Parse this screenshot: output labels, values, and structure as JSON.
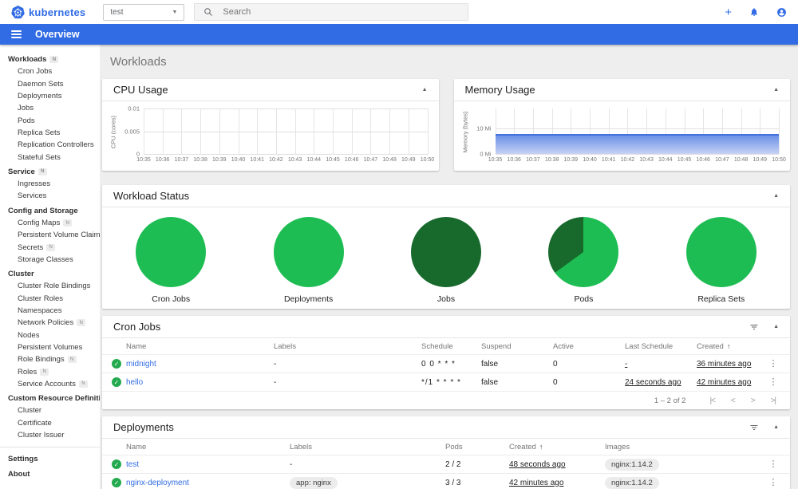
{
  "colors": {
    "brand_blue": "#326ce5",
    "link_blue": "#326ce5",
    "pie_green": "#1ebd53",
    "pie_dark_green": "#17692c",
    "status_ok_green": "#23a94e",
    "memory_fill_top": "#6b91e7",
    "memory_fill_bottom": "#c6d2f4"
  },
  "header": {
    "logo_text": "kubernetes",
    "namespace_value": "test",
    "search_placeholder": "Search"
  },
  "navbar": {
    "title": "Overview"
  },
  "page": {
    "title": "Workloads"
  },
  "sidebar": {
    "groups": [
      {
        "label": "Workloads",
        "badge": true,
        "items": [
          {
            "label": "Cron Jobs"
          },
          {
            "label": "Daemon Sets"
          },
          {
            "label": "Deployments"
          },
          {
            "label": "Jobs"
          },
          {
            "label": "Pods"
          },
          {
            "label": "Replica Sets"
          },
          {
            "label": "Replication Controllers"
          },
          {
            "label": "Stateful Sets"
          }
        ]
      },
      {
        "label": "Service",
        "badge": true,
        "items": [
          {
            "label": "Ingresses"
          },
          {
            "label": "Services"
          }
        ]
      },
      {
        "label": "Config and Storage",
        "badge": false,
        "items": [
          {
            "label": "Config Maps",
            "badge": true
          },
          {
            "label": "Persistent Volume Claims",
            "badge": true
          },
          {
            "label": "Secrets",
            "badge": true
          },
          {
            "label": "Storage Classes"
          }
        ]
      },
      {
        "label": "Cluster",
        "badge": false,
        "items": [
          {
            "label": "Cluster Role Bindings"
          },
          {
            "label": "Cluster Roles"
          },
          {
            "label": "Namespaces"
          },
          {
            "label": "Network Policies",
            "badge": true
          },
          {
            "label": "Nodes"
          },
          {
            "label": "Persistent Volumes"
          },
          {
            "label": "Role Bindings",
            "badge": true
          },
          {
            "label": "Roles",
            "badge": true
          },
          {
            "label": "Service Accounts",
            "badge": true
          }
        ]
      },
      {
        "label": "Custom Resource Definitions",
        "badge": false,
        "items": [
          {
            "label": "Cluster"
          },
          {
            "label": "Certificate"
          },
          {
            "label": "Cluster Issuer"
          }
        ]
      }
    ],
    "footer_items": [
      {
        "label": "Settings"
      },
      {
        "label": "About"
      }
    ]
  },
  "chart_data": [
    {
      "id": "cpu",
      "type": "line",
      "title": "CPU Usage",
      "ylabel": "CPU (cores)",
      "x": [
        "10:35",
        "10:36",
        "10:37",
        "10:38",
        "10:39",
        "10:40",
        "10:41",
        "10:42",
        "10:43",
        "10:44",
        "10:45",
        "10:46",
        "10:47",
        "10:48",
        "10:49",
        "10:50"
      ],
      "yticks": [
        "0.01",
        "0.005",
        "0"
      ],
      "ylim": [
        0,
        0.01
      ],
      "grid": true,
      "series": []
    },
    {
      "id": "memory",
      "type": "area",
      "title": "Memory Usage",
      "ylabel": "Memory (bytes)",
      "x": [
        "10:35",
        "10:36",
        "10:37",
        "10:38",
        "10:39",
        "10:40",
        "10:41",
        "10:42",
        "10:43",
        "10:44",
        "10:45",
        "10:46",
        "10:47",
        "10:48",
        "10:49",
        "10:50"
      ],
      "yticks": [
        "10 Mi",
        "0 Mi"
      ],
      "ylim_mi": [
        0,
        13
      ],
      "grid": true,
      "series": [
        {
          "name": "memory usage",
          "unit": "Mi",
          "values": [
            7.5,
            7.5,
            7.5,
            7.5,
            7.5,
            7.5,
            7.5,
            7.5,
            7.5,
            7.5,
            7.5,
            7.5,
            7.5,
            7.5,
            7.5,
            7.5
          ]
        }
      ]
    }
  ],
  "workload_status": {
    "title": "Workload Status",
    "pies": [
      {
        "label": "Cron Jobs",
        "segments": [
          {
            "name": "light-green",
            "fraction": 1,
            "color": "#1ebd53"
          }
        ]
      },
      {
        "label": "Deployments",
        "segments": [
          {
            "name": "light-green",
            "fraction": 1,
            "color": "#1ebd53"
          }
        ]
      },
      {
        "label": "Jobs",
        "segments": [
          {
            "name": "dark-green",
            "fraction": 1,
            "color": "#17692c"
          }
        ]
      },
      {
        "label": "Pods",
        "segments": [
          {
            "name": "light-green",
            "fraction": 0.65,
            "color": "#1ebd53"
          },
          {
            "name": "dark-green",
            "fraction": 0.35,
            "color": "#17692c"
          }
        ]
      },
      {
        "label": "Replica Sets",
        "segments": [
          {
            "name": "light-green",
            "fraction": 1,
            "color": "#1ebd53"
          }
        ]
      }
    ]
  },
  "cron_jobs": {
    "title": "Cron Jobs",
    "columns": [
      "Name",
      "Labels",
      "Schedule",
      "Suspend",
      "Active",
      "Last Schedule",
      "Created"
    ],
    "sort_indicator": "↑",
    "rows": [
      {
        "name": "midnight",
        "labels": "-",
        "schedule": "0 0 * * *",
        "suspend": "false",
        "active": "0",
        "last_schedule": "-",
        "created": "36 minutes ago"
      },
      {
        "name": "hello",
        "labels": "-",
        "schedule": "*/1 * * * *",
        "suspend": "false",
        "active": "0",
        "last_schedule": "24 seconds ago",
        "created": "42 minutes ago"
      }
    ],
    "pagination": {
      "range_label": "1 – 2 of 2"
    }
  },
  "deployments": {
    "title": "Deployments",
    "columns": [
      "Name",
      "Labels",
      "Pods",
      "Created",
      "Images"
    ],
    "sort_indicator": "↑",
    "rows": [
      {
        "name": "test",
        "labels": {
          "text": "-",
          "chip": false
        },
        "pods": "2 / 2",
        "created": "48 seconds ago",
        "images": [
          "nginx:1.14.2"
        ]
      },
      {
        "name": "nginx-deployment",
        "labels": {
          "text": "app: nginx",
          "chip": true
        },
        "pods": "3 / 3",
        "created": "42 minutes ago",
        "images": [
          "nginx:1.14.2"
        ]
      }
    ]
  }
}
